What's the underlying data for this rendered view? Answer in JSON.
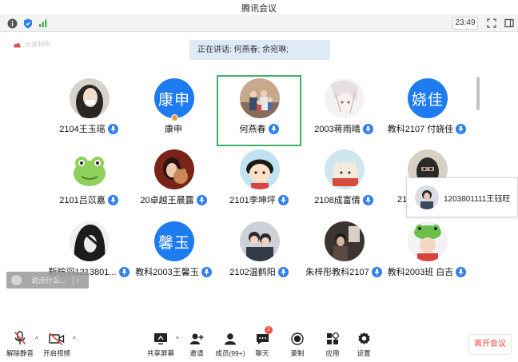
{
  "window": {
    "title": "腾讯会议"
  },
  "status": {
    "time": "23:49"
  },
  "recording": {
    "label": "云录制中"
  },
  "speaking": {
    "label": "正在讲话: 何燕春; 余宛琳;"
  },
  "participants": [
    {
      "name": "2104王玉瑶",
      "avatar": "photo-girl",
      "mic": true
    },
    {
      "name": "康申",
      "avatar_text": "康申",
      "mic": false,
      "host": true
    },
    {
      "name": "何燕春",
      "avatar": "photo-family",
      "mic": true,
      "speaking": true
    },
    {
      "name": "2003蒋雨晴",
      "avatar": "anime",
      "mic": true
    },
    {
      "name": "教科2107 付娆佳",
      "avatar_text": "娆佳",
      "mic": true
    },
    {
      "name": "2101吕苡嘉",
      "avatar": "frog",
      "mic": true
    },
    {
      "name": "20卓越王晨露",
      "avatar": "photo-bear",
      "mic": true
    },
    {
      "name": "2101李坤坪",
      "avatar": "cartoon-girl",
      "mic": true
    },
    {
      "name": "2108成富倩",
      "avatar": "cartoon-cat",
      "mic": true
    },
    {
      "name": "21",
      "avatar": "mask",
      "mic": true
    },
    {
      "name": "靳晗羽1213801...",
      "avatar": "dark-hair",
      "mic": true
    },
    {
      "name": "教科2003王馨玉",
      "avatar_text": "馨玉",
      "mic": true
    },
    {
      "name": "2102温鹤阳",
      "avatar": "couple",
      "mic": true
    },
    {
      "name": "朱梓彤教科2107",
      "avatar": "dim-photo",
      "mic": true
    },
    {
      "name": "教科2003班 白吉",
      "avatar": "frog-hat",
      "mic": true
    }
  ],
  "hover_card": {
    "name": "1203801111王钰旺"
  },
  "chat": {
    "placeholder": "说点什么..."
  },
  "toolbar": {
    "mute": "解除静音",
    "video": "开启视频",
    "share": "共享屏幕",
    "invite": "邀请",
    "members": "成员(99+)",
    "chat": "聊天",
    "chat_badge": "2",
    "record": "录制",
    "apps": "应用",
    "settings": "设置",
    "leave": "离开会议"
  },
  "colors": {
    "accent": "#2f80ed",
    "speaking_frame": "#40b06a",
    "leave": "#e44444",
    "badge": "#f04e3e"
  }
}
